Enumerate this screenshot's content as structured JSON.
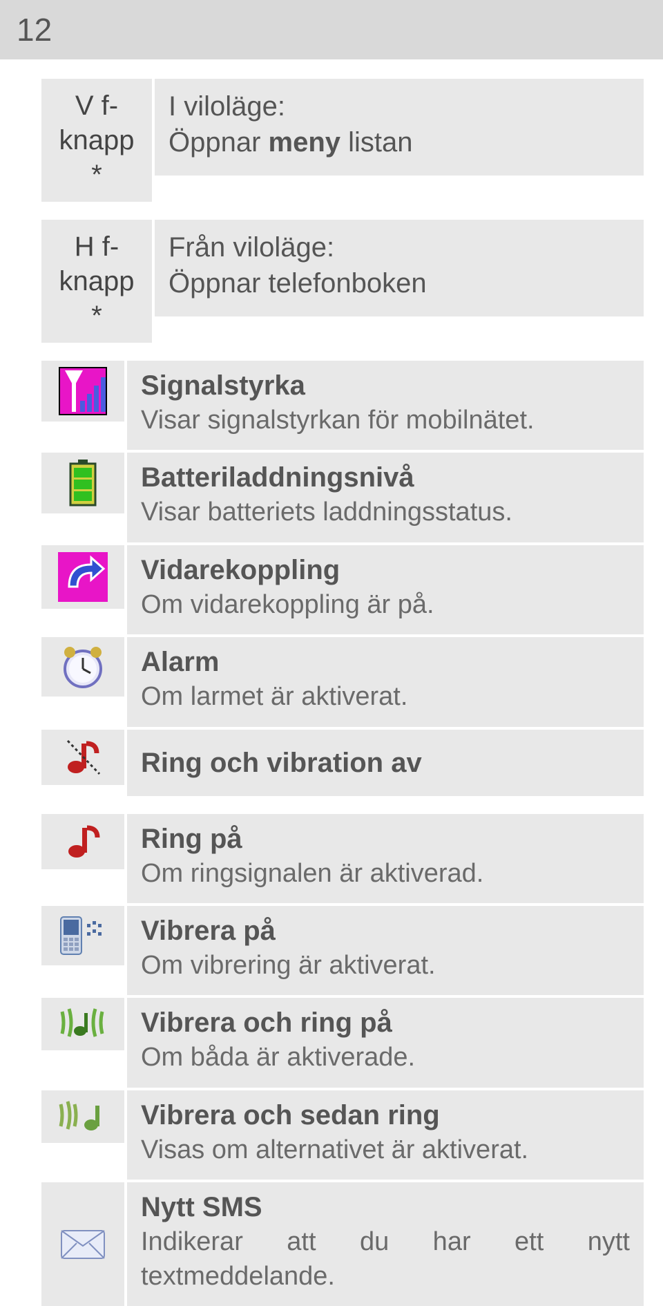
{
  "page_number": "12",
  "rows": [
    {
      "left": {
        "line1": "V f-",
        "line2": "knapp",
        "line3": "*"
      },
      "title_prefix": "I viloläge:",
      "title_line2_a": "Öppnar ",
      "title_line2_b": "meny",
      "title_line2_c": " listan"
    },
    {
      "left": {
        "line1": "H f-",
        "line2": "knapp",
        "line3": "*"
      },
      "title_prefix": "Från viloläge:",
      "title_line2": "Öppnar telefonboken"
    },
    {
      "title": "Signalstyrka",
      "desc": "Visar signalstyrkan för mobilnätet."
    },
    {
      "title": "Batteriladdningsnivå",
      "desc": "Visar batteriets laddningsstatus."
    },
    {
      "title": "Vidarekoppling",
      "desc": "Om vidarekoppling är på."
    },
    {
      "title": "Alarm",
      "desc": "Om larmet är aktiverat."
    },
    {
      "title": "Ring och vibration av",
      "desc": ""
    },
    {
      "title": "Ring på",
      "desc": "Om ringsignalen är aktiverad."
    },
    {
      "title": "Vibrera på",
      "desc": "Om vibrering är aktiverat."
    },
    {
      "title": "Vibrera och ring på",
      "desc": "Om båda är aktiverade."
    },
    {
      "title": "Vibrera och sedan ring",
      "desc": "Visas om alternativet är aktiverat."
    },
    {
      "title": "Nytt SMS",
      "desc": "Indikerar att du har ett nytt textmeddelande."
    }
  ]
}
